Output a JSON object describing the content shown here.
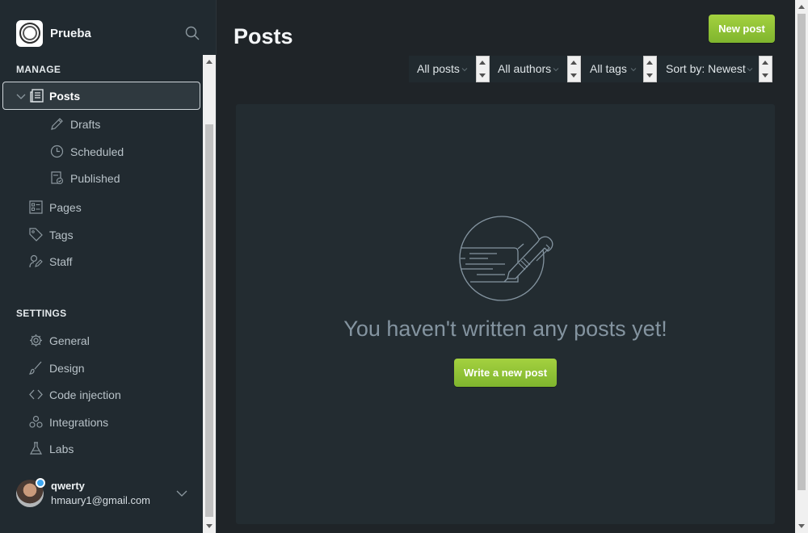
{
  "brand": {
    "name": "Prueba",
    "search_icon": "search-icon"
  },
  "sidebar": {
    "manage_title": "MANAGE",
    "settings_title": "SETTINGS",
    "items": [
      {
        "label": "Posts",
        "icon": "posts-icon",
        "active": true
      },
      {
        "label": "Drafts",
        "icon": "pencil-icon"
      },
      {
        "label": "Scheduled",
        "icon": "clock-icon"
      },
      {
        "label": "Published",
        "icon": "published-icon"
      },
      {
        "label": "Pages",
        "icon": "pages-icon"
      },
      {
        "label": "Tags",
        "icon": "tag-icon"
      },
      {
        "label": "Staff",
        "icon": "staff-icon"
      }
    ],
    "settings": [
      {
        "label": "General",
        "icon": "gear-icon"
      },
      {
        "label": "Design",
        "icon": "brush-icon"
      },
      {
        "label": "Code injection",
        "icon": "code-icon"
      },
      {
        "label": "Integrations",
        "icon": "integrations-icon"
      },
      {
        "label": "Labs",
        "icon": "flask-icon"
      }
    ]
  },
  "user": {
    "name": "qwerty",
    "email": "hmaury1@gmail.com",
    "status_color": "#3ea6f0"
  },
  "main": {
    "title": "Posts",
    "new_post_label": "New post",
    "filters": {
      "type": "All posts",
      "author": "All authors",
      "tag": "All tags",
      "sort": "Sort by: Newest"
    },
    "empty_message": "You haven't written any posts yet!",
    "write_label": "Write a new post"
  },
  "colors": {
    "accent_green": "#9fcb3d",
    "sidebar_bg": "#212a30",
    "main_bg": "#1f2428",
    "panel_bg": "#232c31"
  }
}
